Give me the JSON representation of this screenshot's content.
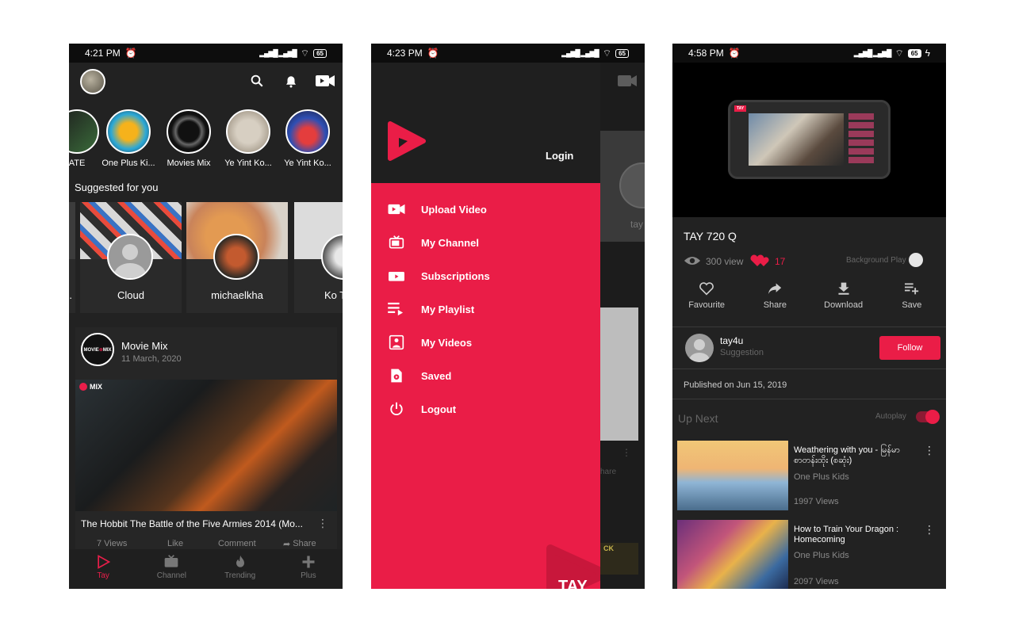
{
  "colors": {
    "accent": "#ea1d47",
    "bg": "#222222",
    "card": "#2a2a2a"
  },
  "phone1": {
    "status": {
      "time": "4:21 PM",
      "battery": "65"
    },
    "stories": [
      {
        "label": "ATE"
      },
      {
        "label": "One Plus Ki..."
      },
      {
        "label": "Movies Mix"
      },
      {
        "label": "Ye Yint Ko..."
      },
      {
        "label": "Ye Yint Ko..."
      }
    ],
    "suggested_title": "Suggested for you",
    "suggested": [
      {
        "name": "..."
      },
      {
        "name": "Cloud"
      },
      {
        "name": "michaelkha"
      },
      {
        "name": "Ko T"
      }
    ],
    "post": {
      "channel": "Movie Mix",
      "date": "11 March, 2020",
      "logo_text": "MIX",
      "title": "The Hobbit The Battle of the Five Armies 2014 (Mo...",
      "views": "7 Views",
      "like": "Like",
      "comment": "Comment",
      "share": "Share"
    },
    "nav": [
      {
        "label": "Tay",
        "icon": "play-icon"
      },
      {
        "label": "Channel",
        "icon": "tv-icon"
      },
      {
        "label": "Trending",
        "icon": "flame-icon"
      },
      {
        "label": "Plus",
        "icon": "plus-icon"
      }
    ]
  },
  "phone2": {
    "status": {
      "time": "4:23 PM",
      "battery": "65"
    },
    "login": "Login",
    "menu": [
      {
        "label": "Upload Video",
        "icon": "video-camera-icon"
      },
      {
        "label": "My Channel",
        "icon": "tv-icon"
      },
      {
        "label": "Subscriptions",
        "icon": "subscriptions-icon"
      },
      {
        "label": "My Playlist",
        "icon": "playlist-icon"
      },
      {
        "label": "My Videos",
        "icon": "my-videos-icon"
      },
      {
        "label": "Saved",
        "icon": "saved-icon"
      },
      {
        "label": "Logout",
        "icon": "power-icon"
      }
    ],
    "bg_text": {
      "name_fragment": "tay",
      "share_fragment": "hare",
      "pick_fragment": "CK"
    },
    "watermark": "TAY"
  },
  "phone3": {
    "status": {
      "time": "4:58 PM",
      "battery": "65"
    },
    "video_title": "TAY 720 Q",
    "views": "300 view",
    "likes": "17",
    "background_play": "Background Play",
    "actions": [
      {
        "label": "Favourite",
        "icon": "heart-icon"
      },
      {
        "label": "Share",
        "icon": "share-icon"
      },
      {
        "label": "Download",
        "icon": "download-icon"
      },
      {
        "label": "Save",
        "icon": "playlist-add-icon"
      }
    ],
    "channel": {
      "name": "tay4u",
      "sub": "Suggestion",
      "follow": "Follow"
    },
    "published": "Published on Jun 15, 2019",
    "up_next": "Up Next",
    "autoplay": "Autoplay",
    "next": [
      {
        "title": "Weathering with you - မြန်မာစာတန်းထိုး (စဆုံး)",
        "channel": "One Plus Kids",
        "views": "1997 Views"
      },
      {
        "title": "How to Train Your Dragon : Homecoming",
        "channel": "One Plus Kids",
        "views": "2097 Views"
      }
    ],
    "hero_badge": "TAY"
  }
}
